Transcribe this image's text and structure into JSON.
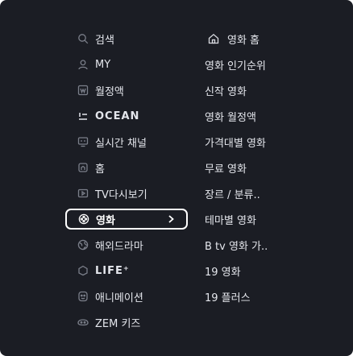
{
  "menu": {
    "left": [
      {
        "label": "검색",
        "icon": "search-icon"
      },
      {
        "label": "MY",
        "icon": "user-icon"
      },
      {
        "label": "월정액",
        "icon": "monthly-ticket-icon"
      },
      {
        "label": "OCEAN",
        "icon": "ocean-logo-icon"
      },
      {
        "label": "실시간 채널",
        "icon": "live-tv-icon"
      },
      {
        "label": "홈",
        "icon": "home-icon"
      },
      {
        "label": "TV다시보기",
        "icon": "replay-icon"
      },
      {
        "label": "영화",
        "icon": "film-reel-icon",
        "selected": true
      },
      {
        "label": "해외드라마",
        "icon": "globe-icon"
      },
      {
        "label": "LIFE⁺",
        "icon": "life-icon"
      },
      {
        "label": "애니메이션",
        "icon": "animation-icon"
      },
      {
        "label": "ZEM 키즈",
        "icon": "kids-icon"
      }
    ],
    "right": [
      {
        "label": "영화 홈",
        "icon": "home-icon"
      },
      {
        "label": "영화 인기순위"
      },
      {
        "label": "신작 영화"
      },
      {
        "label": "영화 월정액"
      },
      {
        "label": "가격대별 영화"
      },
      {
        "label": "무료 영화"
      },
      {
        "label": "장르 / 분류.."
      },
      {
        "label": "테마별 영화"
      },
      {
        "label": "B tv 영화 가.."
      },
      {
        "label": "19 영화"
      },
      {
        "label": "19 플러스"
      }
    ]
  },
  "colors": {
    "background": "#1b1d24",
    "text": "#e4e6ec",
    "icon": "#7b7f8a",
    "selection_border": "#ffffff"
  }
}
